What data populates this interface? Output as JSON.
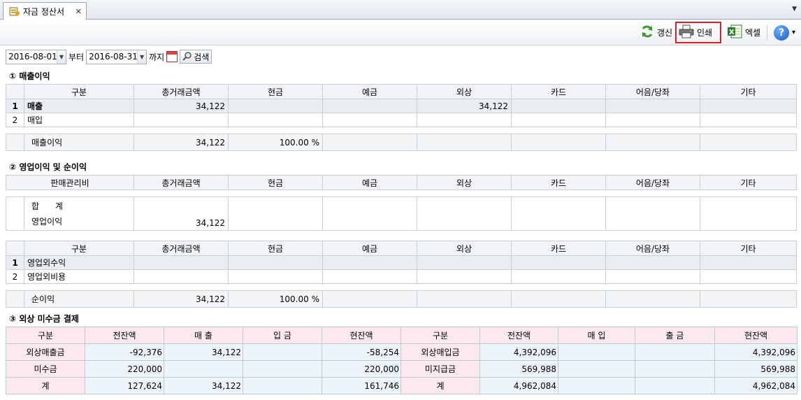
{
  "tab": {
    "title": "자금 정산서",
    "close": "✕",
    "menu_arrow": "▼"
  },
  "toolbar": {
    "refresh_label": "갱신",
    "print_label": "인쇄",
    "excel_label": "엑셀",
    "help_label": "?",
    "help_arrow": "▾"
  },
  "filter": {
    "start_date": "2016-08-01",
    "from_label": "부터",
    "end_date": "2016-08-31",
    "to_label": "까지",
    "search_label": "검색",
    "dropdown_glyph": "▼"
  },
  "sections": {
    "s1": "① 매출이익",
    "s2": "② 영업이익 및 순이익",
    "s3": "③ 외상 미수금 결제"
  },
  "columns": [
    "구분",
    "총거래금액",
    "현금",
    "예금",
    "외상",
    "카드",
    "어음/당좌",
    "기타"
  ],
  "columns_opex": [
    "판매관리비",
    "총거래금액",
    "현금",
    "예금",
    "외상",
    "카드",
    "어음/당좌",
    "기타"
  ],
  "sales_table": {
    "rows": [
      {
        "no": "1",
        "label": "매출",
        "total": "34,122",
        "cash": "",
        "deposit": "",
        "credit": "34,122",
        "card": "",
        "bill": "",
        "etc": ""
      },
      {
        "no": "2",
        "label": "매입",
        "total": "",
        "cash": "",
        "deposit": "",
        "credit": "",
        "card": "",
        "bill": "",
        "etc": ""
      }
    ],
    "footer": {
      "label": "매출이익",
      "total": "34,122",
      "ratio": "100.00 %"
    }
  },
  "opex_table": {
    "sum_label": "합      계",
    "op_label": "영업이익",
    "op_total": "34,122"
  },
  "nonop_table": {
    "rows": [
      {
        "no": "1",
        "label": "영업외수익"
      },
      {
        "no": "2",
        "label": "영업외비용"
      }
    ],
    "footer": {
      "label": "순이익",
      "total": "34,122",
      "ratio": "100.00 %"
    }
  },
  "settlement": {
    "headers": [
      "구분",
      "전잔액",
      "매 출",
      "입 금",
      "현잔액",
      "구분",
      "전잔액",
      "매 입",
      "출 금",
      "현잔액"
    ],
    "rows": [
      [
        "외상매출금",
        "-92,376",
        "34,122",
        "",
        "-58,254",
        "외상매입금",
        "4,392,096",
        "",
        "",
        "4,392,096"
      ],
      [
        "미수금",
        "220,000",
        "",
        "",
        "220,000",
        "미지급금",
        "569,988",
        "",
        "",
        "569,988"
      ],
      [
        "계",
        "127,624",
        "34,122",
        "",
        "161,746",
        "계",
        "4,962,084",
        "",
        "",
        "4,962,084"
      ]
    ]
  }
}
